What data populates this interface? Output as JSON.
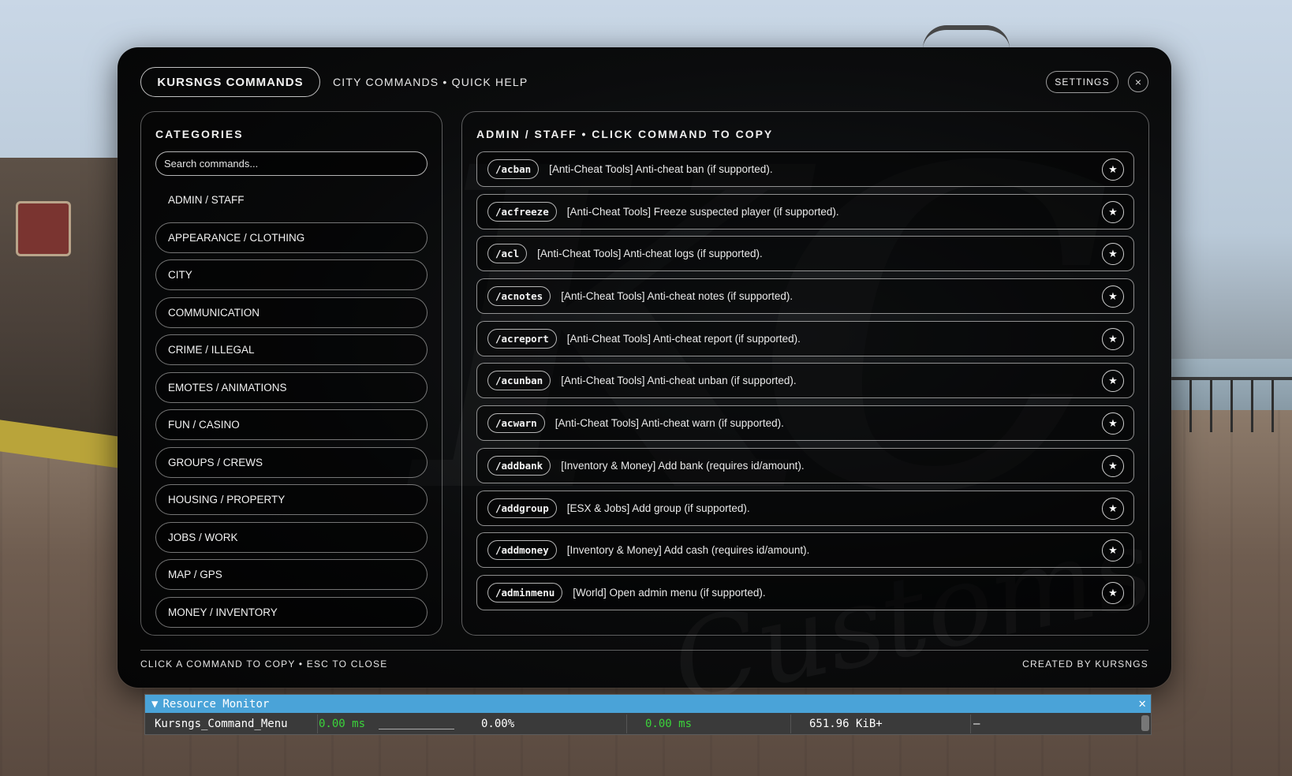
{
  "header": {
    "brand": "KURSNGS COMMANDS",
    "subtitle": "CITY COMMANDS • QUICK HELP",
    "settings_label": "SETTINGS",
    "close_glyph": "×"
  },
  "sidebar": {
    "title": "CATEGORIES",
    "search_placeholder": "Search commands...",
    "categories": [
      "ADMIN / STAFF",
      "APPEARANCE / CLOTHING",
      "CITY",
      "COMMUNICATION",
      "CRIME / ILLEGAL",
      "EMOTES / ANIMATIONS",
      "FUN / CASINO",
      "GROUPS / CREWS",
      "HOUSING / PROPERTY",
      "JOBS / WORK",
      "MAP / GPS",
      "MONEY / INVENTORY"
    ],
    "active_category": "ADMIN / STAFF"
  },
  "commands": {
    "title": "ADMIN / STAFF • CLICK COMMAND TO COPY",
    "star_glyph": "★",
    "items": [
      {
        "cmd": "/acban",
        "desc": "[Anti-Cheat Tools] Anti-cheat ban (if supported)."
      },
      {
        "cmd": "/acfreeze",
        "desc": "[Anti-Cheat Tools] Freeze suspected player (if supported)."
      },
      {
        "cmd": "/acl",
        "desc": "[Anti-Cheat Tools] Anti-cheat logs (if supported)."
      },
      {
        "cmd": "/acnotes",
        "desc": "[Anti-Cheat Tools] Anti-cheat notes (if supported)."
      },
      {
        "cmd": "/acreport",
        "desc": "[Anti-Cheat Tools] Anti-cheat report (if supported)."
      },
      {
        "cmd": "/acunban",
        "desc": "[Anti-Cheat Tools] Anti-cheat unban (if supported)."
      },
      {
        "cmd": "/acwarn",
        "desc": "[Anti-Cheat Tools] Anti-cheat warn (if supported)."
      },
      {
        "cmd": "/addbank",
        "desc": "[Inventory & Money] Add bank (requires id/amount)."
      },
      {
        "cmd": "/addgroup",
        "desc": "[ESX & Jobs] Add group (if supported)."
      },
      {
        "cmd": "/addmoney",
        "desc": "[Inventory & Money] Add cash (requires id/amount)."
      },
      {
        "cmd": "/adminmenu",
        "desc": "[World] Open admin menu (if supported)."
      }
    ]
  },
  "footer": {
    "left": "CLICK A COMMAND TO COPY • ESC TO CLOSE",
    "right": "CREATED BY KURSNGS"
  },
  "watermark": {
    "text": "Customs"
  },
  "resource_monitor": {
    "title": "Resource Monitor",
    "toggle_glyph": "▼",
    "close_glyph": "✕",
    "row": {
      "name": "Kursngs_Command_Menu",
      "cpu_ms": "0.00 ms",
      "cpu_pct": "0.00%",
      "tick_ms": "0.00 ms",
      "memory": "651.96 KiB+",
      "extra": "–"
    }
  },
  "colors": {
    "panel_bg": "#0b0c0d",
    "monitor_bar": "#4aa3d8",
    "monitor_green": "#3ad43a"
  }
}
